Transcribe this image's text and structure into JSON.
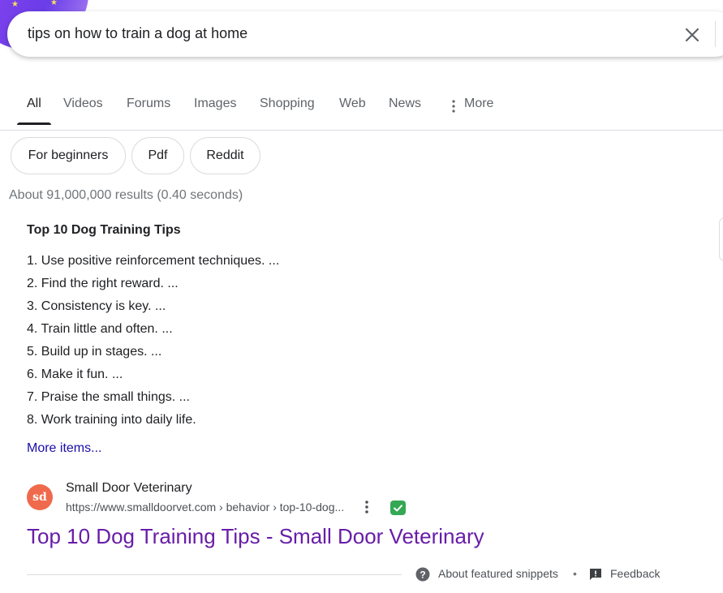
{
  "search": {
    "query": "tips on how to train a dog at home"
  },
  "tabs": [
    {
      "label": "All"
    },
    {
      "label": "Videos"
    },
    {
      "label": "Forums"
    },
    {
      "label": "Images"
    },
    {
      "label": "Shopping"
    },
    {
      "label": "Web"
    },
    {
      "label": "News"
    },
    {
      "label": "More"
    }
  ],
  "chips": [
    {
      "label": "For beginners"
    },
    {
      "label": "Pdf"
    },
    {
      "label": "Reddit"
    }
  ],
  "stats": "About 91,000,000 results (0.40 seconds)",
  "snippet": {
    "title": "Top 10 Dog Training Tips",
    "items": [
      "1. Use positive reinforcement techniques. ...",
      "2. Find the right reward. ...",
      "3. Consistency is key. ...",
      "4. Train little and often. ...",
      "5. Build up in stages. ...",
      "6. Make it fun. ...",
      "7. Praise the small things. ...",
      "8. Work training into daily life."
    ],
    "more_label": "More items..."
  },
  "result": {
    "favicon_text": "sd",
    "site_name": "Small Door Veterinary",
    "url": "https://www.smalldoorvet.com › behavior › top-10-dog...",
    "title": "Top 10 Dog Training Tips - Small Door Veterinary"
  },
  "footer": {
    "about_label": "About featured snippets",
    "separator": "•",
    "feedback_label": "Feedback"
  },
  "colors": {
    "link_visited": "#681da8",
    "link": "#1a0dab",
    "verified_badge": "#34a853",
    "favicon_bg": "#ef6a4c"
  }
}
